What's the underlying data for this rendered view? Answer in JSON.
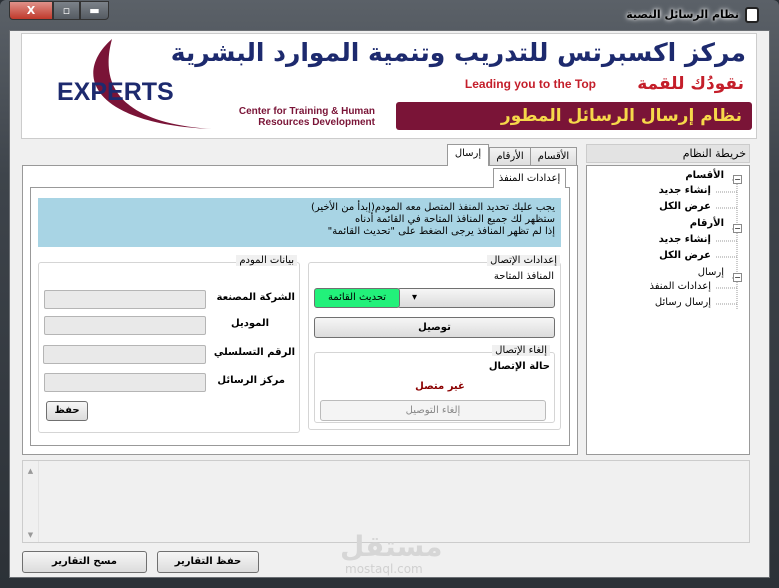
{
  "window": {
    "title": "نظام الرسائل النصية",
    "close": "X",
    "maximize": "▫",
    "minimize": "▬"
  },
  "banner": {
    "headline": "مركز اكسبرتس للتدريب وتنمية الموارد البشرية",
    "slogan_ar": "نقودُك للقمة",
    "slogan_en": "Leading you to the Top",
    "logo": "EXPERTS",
    "subtitle_1": "Center for Training & Human",
    "subtitle_2": "Resources Development",
    "system_name": "نظام إرسال الرسائل المطور",
    "colors": {
      "brand": "#7a1437",
      "navy": "#1d2a6e",
      "gold": "#f6d84a"
    }
  },
  "tabs": [
    {
      "label": "الأقسام"
    },
    {
      "label": "الأرقام"
    },
    {
      "label": "إرسال",
      "active": true
    }
  ],
  "subtab": "إعدادات المنفذ",
  "info": [
    "يجب عليك تحديد المنفذ المتصل معه المودم(إبدأ من الأخير)",
    "ستظهر لك جميع المنافذ المتاحة في القائمة أدناه",
    "إذا لم تظهر المنافذ يرجى الضغط على \"تحديث القائمة\""
  ],
  "connection": {
    "title": "إعدادات الإتصال",
    "ports_label": "المنافذ المتاحة",
    "ports_value": "",
    "refresh": "تحديث القائمة",
    "connect": "توصيل",
    "disconnect_group": "إلغاء الإتصال",
    "status_label": "حالة الإتصال",
    "status": "غير متصل",
    "disconnect": "إلغاء التوصيل"
  },
  "modem": {
    "title": "بيانات المودم",
    "fields": [
      {
        "label": "الشركة المصنعة",
        "value": ""
      },
      {
        "label": "الموديل",
        "value": ""
      },
      {
        "label": "الرقم التسلسلي",
        "value": ""
      },
      {
        "label": "مركز الرسائل",
        "value": ""
      }
    ],
    "save": "حفظ"
  },
  "sitemap": {
    "title": "خريطة النظام",
    "nodes": [
      {
        "label": "الأقسام",
        "children": [
          "إنشاء جديد",
          "عرض الكل"
        ]
      },
      {
        "label": "الأرقام",
        "children": [
          "إنشاء جديد",
          "عرض الكل"
        ]
      },
      {
        "label": "إرسال",
        "children": [
          "إعدادات المنفذ",
          "إرسال رسائل"
        ]
      }
    ]
  },
  "log": {
    "value": ""
  },
  "footer": {
    "clear": "مسح التقارير",
    "save": "حفظ التقارير"
  },
  "watermark": {
    "ar": "مستقل",
    "en": "mostaql.com"
  }
}
